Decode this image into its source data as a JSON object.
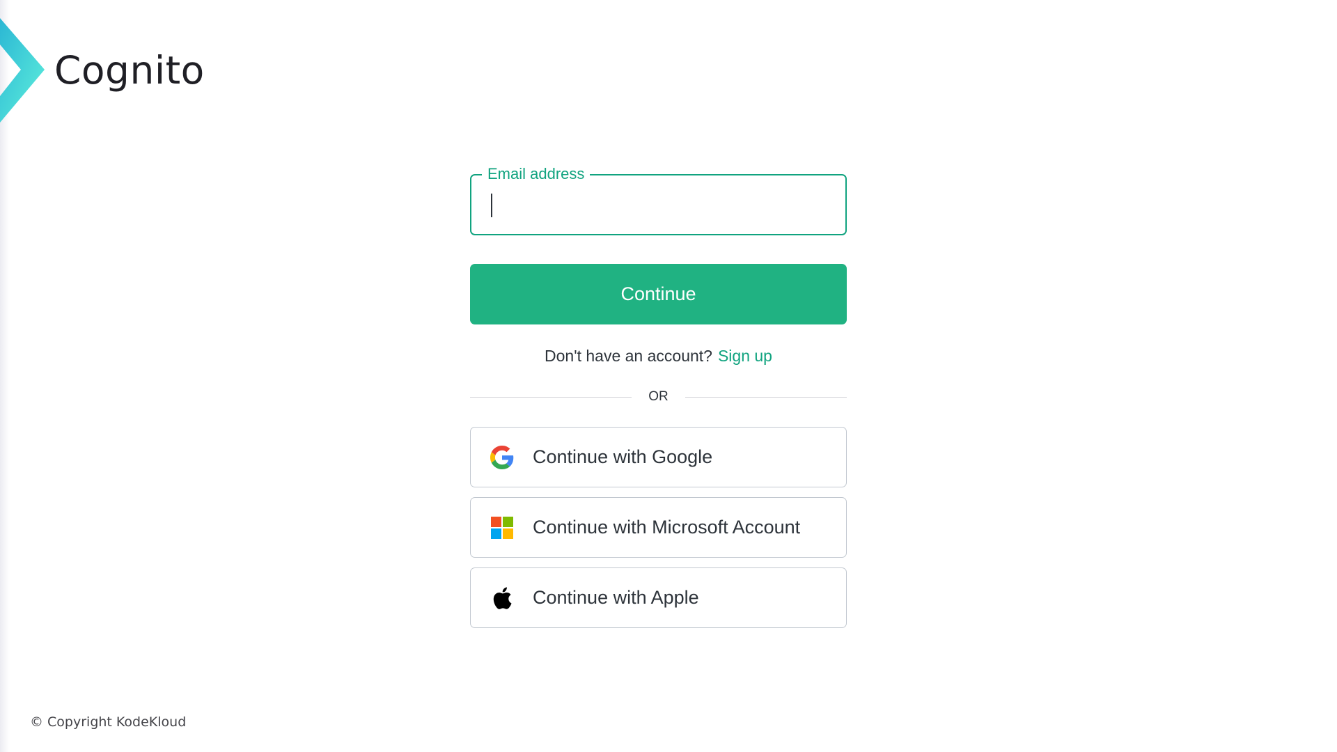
{
  "brand": {
    "name": "Cognito"
  },
  "login": {
    "email_label": "Email address",
    "email_value": "",
    "email_placeholder": "",
    "continue_label": "Continue",
    "signup_prompt": "Don't have an account?",
    "signup_link": "Sign up",
    "divider_text": "OR"
  },
  "social": [
    {
      "label": "Continue with Google",
      "icon": "google-icon"
    },
    {
      "label": "Continue with Microsoft Account",
      "icon": "microsoft-icon"
    },
    {
      "label": "Continue with Apple",
      "icon": "apple-icon"
    }
  ],
  "footer": {
    "copyright": "© Copyright KodeKloud"
  },
  "colors": {
    "accent": "#10a37f",
    "button": "#20b282",
    "text": "#2d333a",
    "border": "#c2c8d0"
  }
}
